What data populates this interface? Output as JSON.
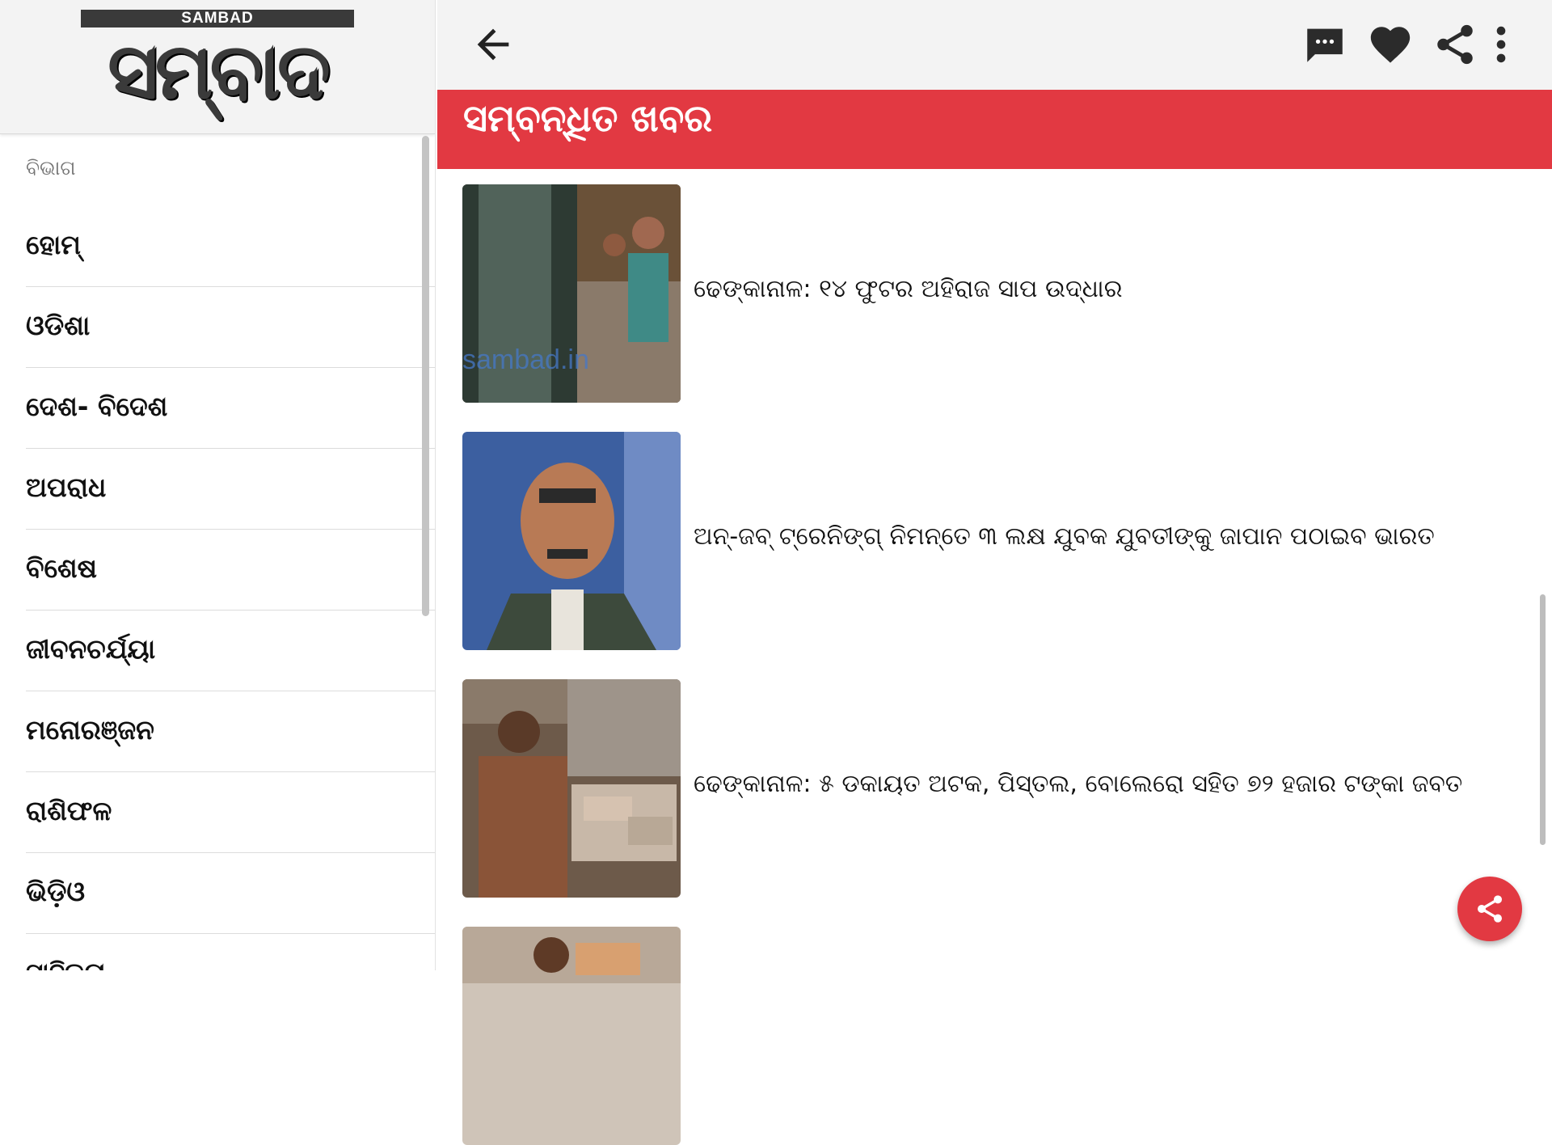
{
  "drawer": {
    "logo_top": "SAMBAD",
    "logo_main": "ସମ୍ବାଦ",
    "section_label": "ବିଭାଗ",
    "items": [
      {
        "label": "ହୋମ୍"
      },
      {
        "label": "ଓଡିଶା"
      },
      {
        "label": "ଦେଶ- ବିଦେଶ"
      },
      {
        "label": "ଅପରାଧ"
      },
      {
        "label": "ବିଶେଷ"
      },
      {
        "label": "ଜୀବନଚର୍ଯ୍ୟା"
      },
      {
        "label": "ମନୋରଞ୍ଜନ"
      },
      {
        "label": "ରାଶିଫଳ"
      },
      {
        "label": "ଭିଡ଼ିଓ"
      },
      {
        "label": "ସାହିତ୍ୟ"
      }
    ]
  },
  "toolbar": {
    "icons": [
      "arrow-back-icon",
      "comment-icon",
      "heart-icon",
      "share-icon",
      "more-vert-icon"
    ]
  },
  "related": {
    "title": "ସମ୍ବନ୍ଧିତ ଖବର",
    "items": [
      {
        "headline": "ଢେଙ୍କାନାଳ: ୧୪ ଫୁଟର ଅହିରାଜ ସାପ ଉଦ୍ଧାର",
        "watermark": "sambad.in"
      },
      {
        "headline": "ଅନ୍-ଜବ୍ ଟ୍ରେନିଙ୍ଗ୍ ନିମନ୍ତେ ୩ ଲକ୍ଷ ଯୁବକ ଯୁବତୀଙ୍କୁ ଜାପାନ ପଠାଇବ ଭାରତ"
      },
      {
        "headline": "ଢେଙ୍କାନାଳ: ୫ ଡକାୟତ ଅଟକ, ପିସ୍ତଲ, ବୋଲେରୋ ସହିତ ୭୨ ହଜାର ଟଙ୍କା ଜବତ"
      },
      {
        "headline": ""
      }
    ]
  },
  "colors": {
    "accent": "#e23942",
    "toolbar_bg": "#f3f3f3"
  }
}
